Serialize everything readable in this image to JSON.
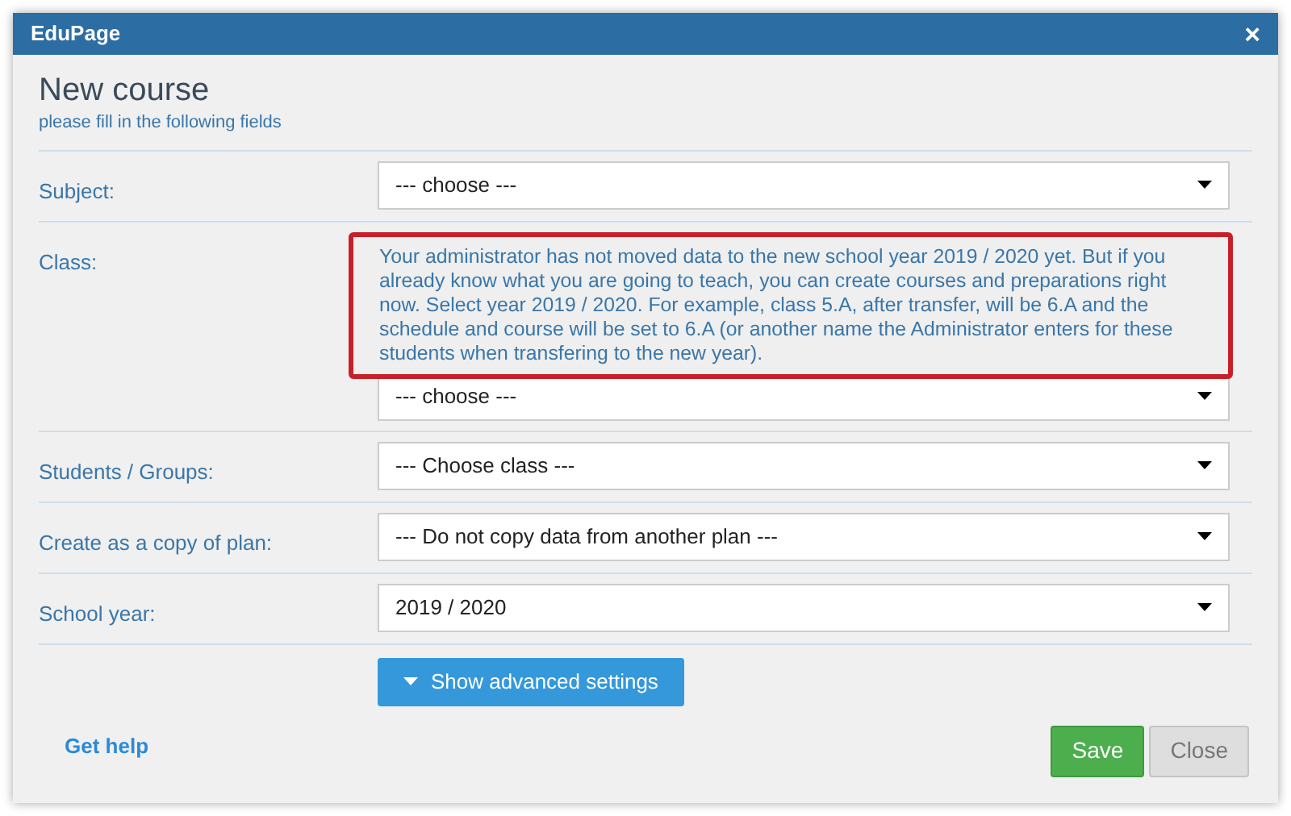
{
  "window": {
    "title": "EduPage",
    "close": "×"
  },
  "heading": {
    "title": "New course",
    "subtitle": "please fill in the following fields"
  },
  "fields": [
    {
      "label": "Subject:",
      "value": "--- choose ---"
    },
    {
      "label": "Class:",
      "note": "Your administrator has not moved data to the new school year 2019 / 2020 yet. But if you already know what you are going to teach, you can create courses and preparations right now. Select year 2019 / 2020. For example, class 5.A, after transfer, will be 6.A and the schedule and course will be set to 6.A (or another name the Administrator enters for these students when transfering to the new year).",
      "value": "--- choose ---"
    },
    {
      "label": "Students / Groups:",
      "value": "--- Choose class ---"
    },
    {
      "label": "Create as a copy of plan:",
      "value": "--- Do not copy data from another plan ---"
    },
    {
      "label": "School year:",
      "value": "2019 / 2020"
    }
  ],
  "advanced_button": "Show advanced settings",
  "help_link": "Get help",
  "buttons": [
    {
      "label": "Save",
      "kind": "primary"
    },
    {
      "label": "Close",
      "kind": "secondary"
    }
  ]
}
